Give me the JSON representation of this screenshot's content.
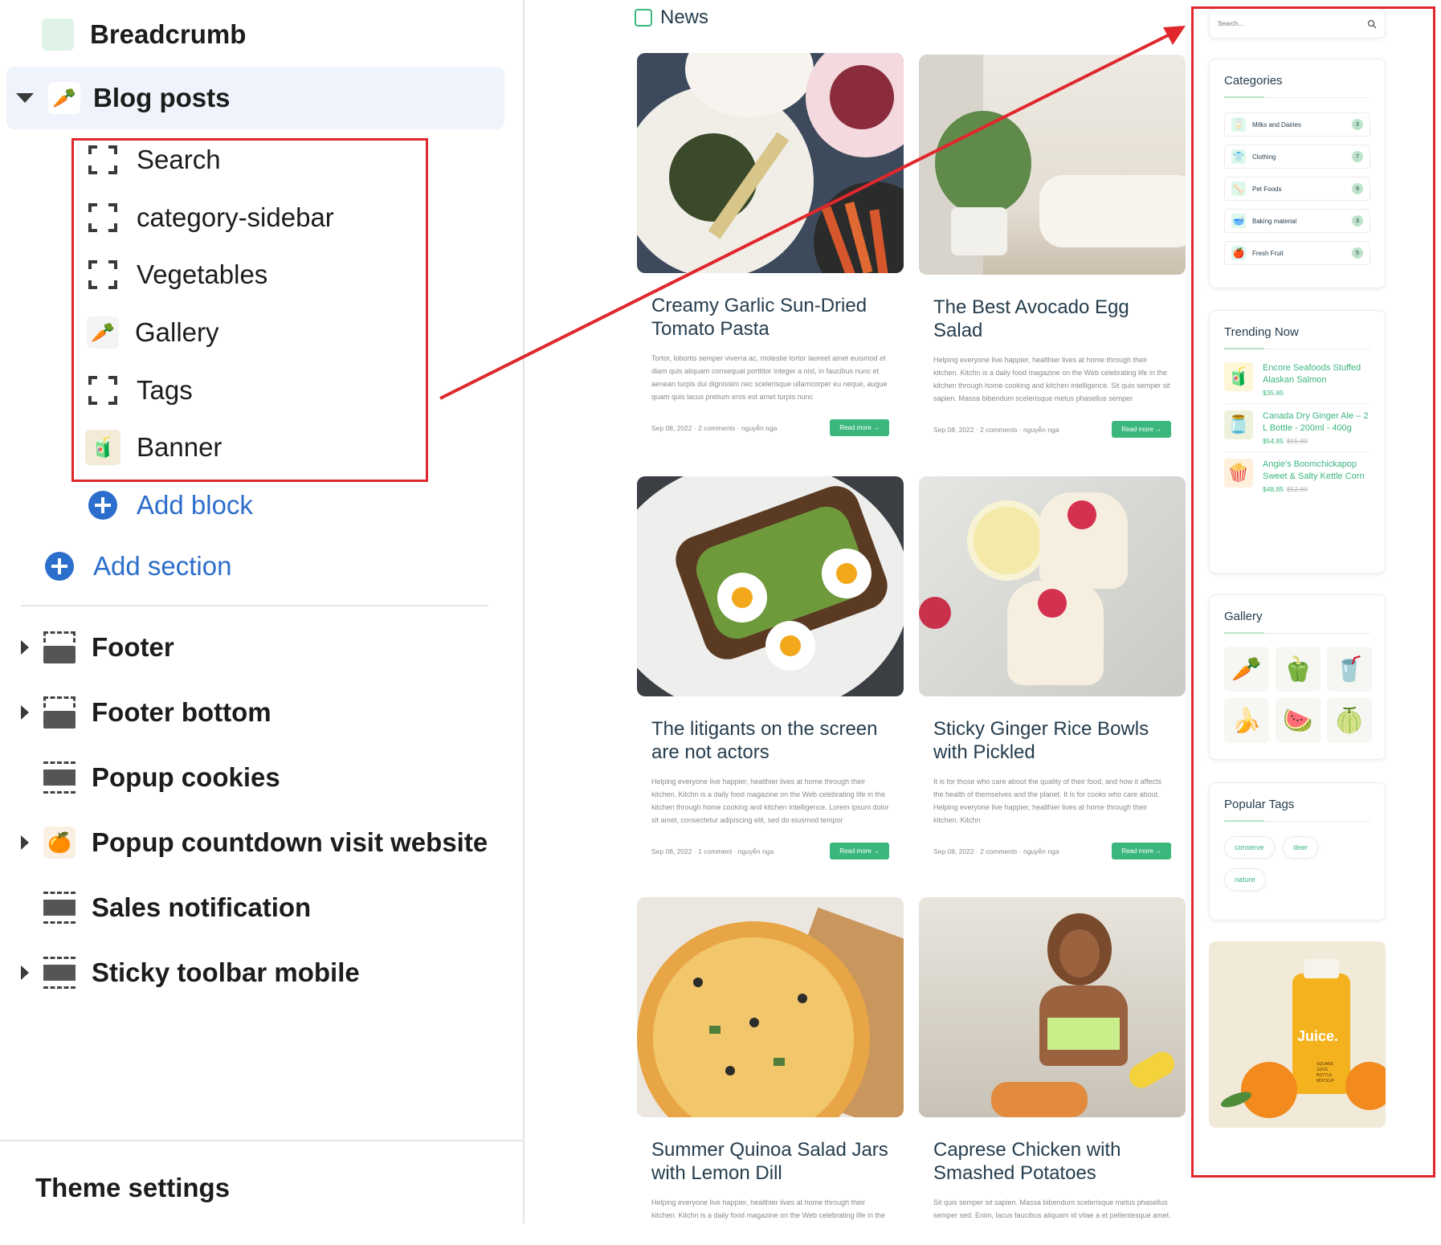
{
  "editor": {
    "breadcrumb_label": "Breadcrumb",
    "blog_posts_label": "Blog posts",
    "blocks": [
      "Search",
      "category-sidebar",
      "Vegetables",
      "Gallery",
      "Tags",
      "Banner"
    ],
    "add_block_label": "Add block",
    "add_section_label": "Add section",
    "sections": [
      "Footer",
      "Footer bottom",
      "Popup cookies",
      "Popup countdown visit website",
      "Sales notification",
      "Sticky toolbar mobile"
    ],
    "theme_settings_label": "Theme settings"
  },
  "preview": {
    "news_title": "News",
    "posts": [
      {
        "title": "Creamy Garlic Sun-Dried Tomato Pasta",
        "excerpt": "Tortor, lobortis semper viverra ac, molestie tortor laoreet amet euismod et diam quis aliquam consequat porttitor integer a nisl, in faucibus nunc et aenean turpis dui dignissim nec scelerisque ullamcorper eu neque, augue quam quis lacus pretium eros est amet turpis nunc",
        "date": "Sep 08, 2022",
        "comments": "2 comments",
        "author": "nguyễn nga",
        "button": "Read more →"
      },
      {
        "title": "The Best Avocado Egg Salad",
        "excerpt": "Helping everyone live happier, healthier lives at home through their kitchen. Kitchn is a daily food magazine on the Web celebrating life in the kitchen through home cooking and kitchen intelligence. Sit quis semper sit sapien. Massa bibendum scelerisque metus phasellus semper",
        "date": "Sep 08, 2022",
        "comments": "2 comments",
        "author": "nguyễn nga",
        "button": "Read more →"
      },
      {
        "title": "The litigants on the screen are not actors",
        "excerpt": "Helping everyone live happier, healthier lives at home through their kitchen. Kitchn is a daily food magazine on the Web celebrating life in the kitchen through home cooking and kitchen intelligence. Lorem ipsum dolor sit amet, consectetur adipiscing elit, sed do eiusmod tempor",
        "date": "Sep 08, 2022",
        "comments": "1 comment",
        "author": "nguyễn nga",
        "button": "Read more →"
      },
      {
        "title": "Sticky Ginger Rice Bowls with Pickled",
        "excerpt": "It is for those who care about the quality of their food, and how it affects the health of themselves and the planet. It is for cooks who care about. Helping everyone live happier, healthier lives at home through their kitchen. Kitchn",
        "date": "Sep 08, 2022",
        "comments": "2 comments",
        "author": "nguyễn nga",
        "button": "Read more →"
      },
      {
        "title": "Summer Quinoa Salad Jars with Lemon Dill",
        "excerpt": "Helping everyone live happier, healthier lives at home through their kitchen. Kitchn is a daily food magazine on the Web celebrating life in the kitchen through home cooking and kitchen intelligence. We've reviewed",
        "date": "",
        "comments": "",
        "author": "",
        "button": ""
      },
      {
        "title": "Caprese Chicken with Smashed Potatoes",
        "excerpt": "Sit quis semper sit sapien. Massa bibendum scelerisque metus phasellus semper sed. Enim, lacus faucibus aliquam id vitae a et pellentesque amet. Felis quam lacinia elementum arcu. Tempor ullamcorper donec sit arcu",
        "date": "",
        "comments": "",
        "author": "",
        "button": ""
      }
    ],
    "search_placeholder": "Search...",
    "categories": {
      "title": "Categories",
      "items": [
        {
          "name": "Milks and Dairies",
          "count": "3"
        },
        {
          "name": "Clothing",
          "count": "7"
        },
        {
          "name": "Pet Foods",
          "count": "9"
        },
        {
          "name": "Baking material",
          "count": "3"
        },
        {
          "name": "Fresh Fruit",
          "count": "5"
        }
      ]
    },
    "trending": {
      "title": "Trending Now",
      "items": [
        {
          "name": "Encore Seafoods Stuffed Alaskan Salmon",
          "price": "$35.85",
          "old_price": ""
        },
        {
          "name": "Canada Dry Ginger Ale – 2 L Bottle - 200ml - 400g",
          "price": "$54.85",
          "old_price": "$55.80"
        },
        {
          "name": "Angie's Boomchickapop Sweet & Salty Kettle Corn",
          "price": "$48.85",
          "old_price": "$52.80"
        }
      ]
    },
    "gallery_title": "Gallery",
    "tags": {
      "title": "Popular Tags",
      "items": [
        "conserve",
        "deer",
        "nature"
      ]
    },
    "banner": {
      "brand": "Juice.",
      "small_text": "SQUARE JUICE BOTTLE MOCKUP"
    }
  },
  "colors": {
    "accent": "#3bb77e",
    "link_blue": "#2c6ecb",
    "annotation_red": "#e0282c",
    "heading": "#253d4e"
  }
}
